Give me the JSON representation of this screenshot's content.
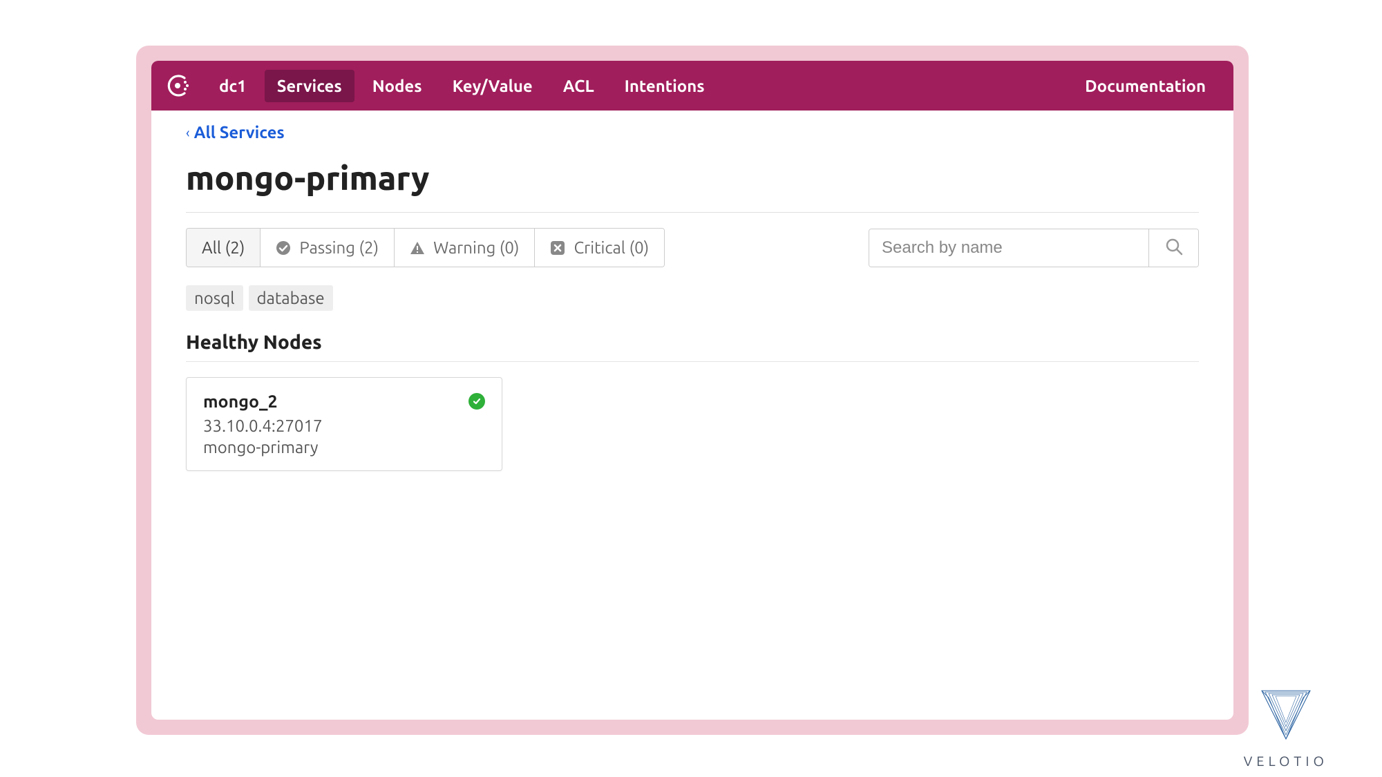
{
  "nav": {
    "datacenter": "dc1",
    "items": [
      "Services",
      "Nodes",
      "Key/Value",
      "ACL",
      "Intentions"
    ],
    "documentation": "Documentation"
  },
  "breadcrumb": {
    "back_label": "All Services"
  },
  "page": {
    "title": "mongo-primary"
  },
  "filters": {
    "all": "All (2)",
    "passing": "Passing (2)",
    "warning": "Warning (0)",
    "critical": "Critical (0)"
  },
  "search": {
    "placeholder": "Search by name"
  },
  "tags": [
    "nosql",
    "database"
  ],
  "section": {
    "healthy_title": "Healthy Nodes"
  },
  "nodes": [
    {
      "name": "mongo_2",
      "address": "33.10.0.4:27017",
      "service": "mongo-primary"
    }
  ],
  "footer": {
    "brand": "VELOTIO"
  }
}
